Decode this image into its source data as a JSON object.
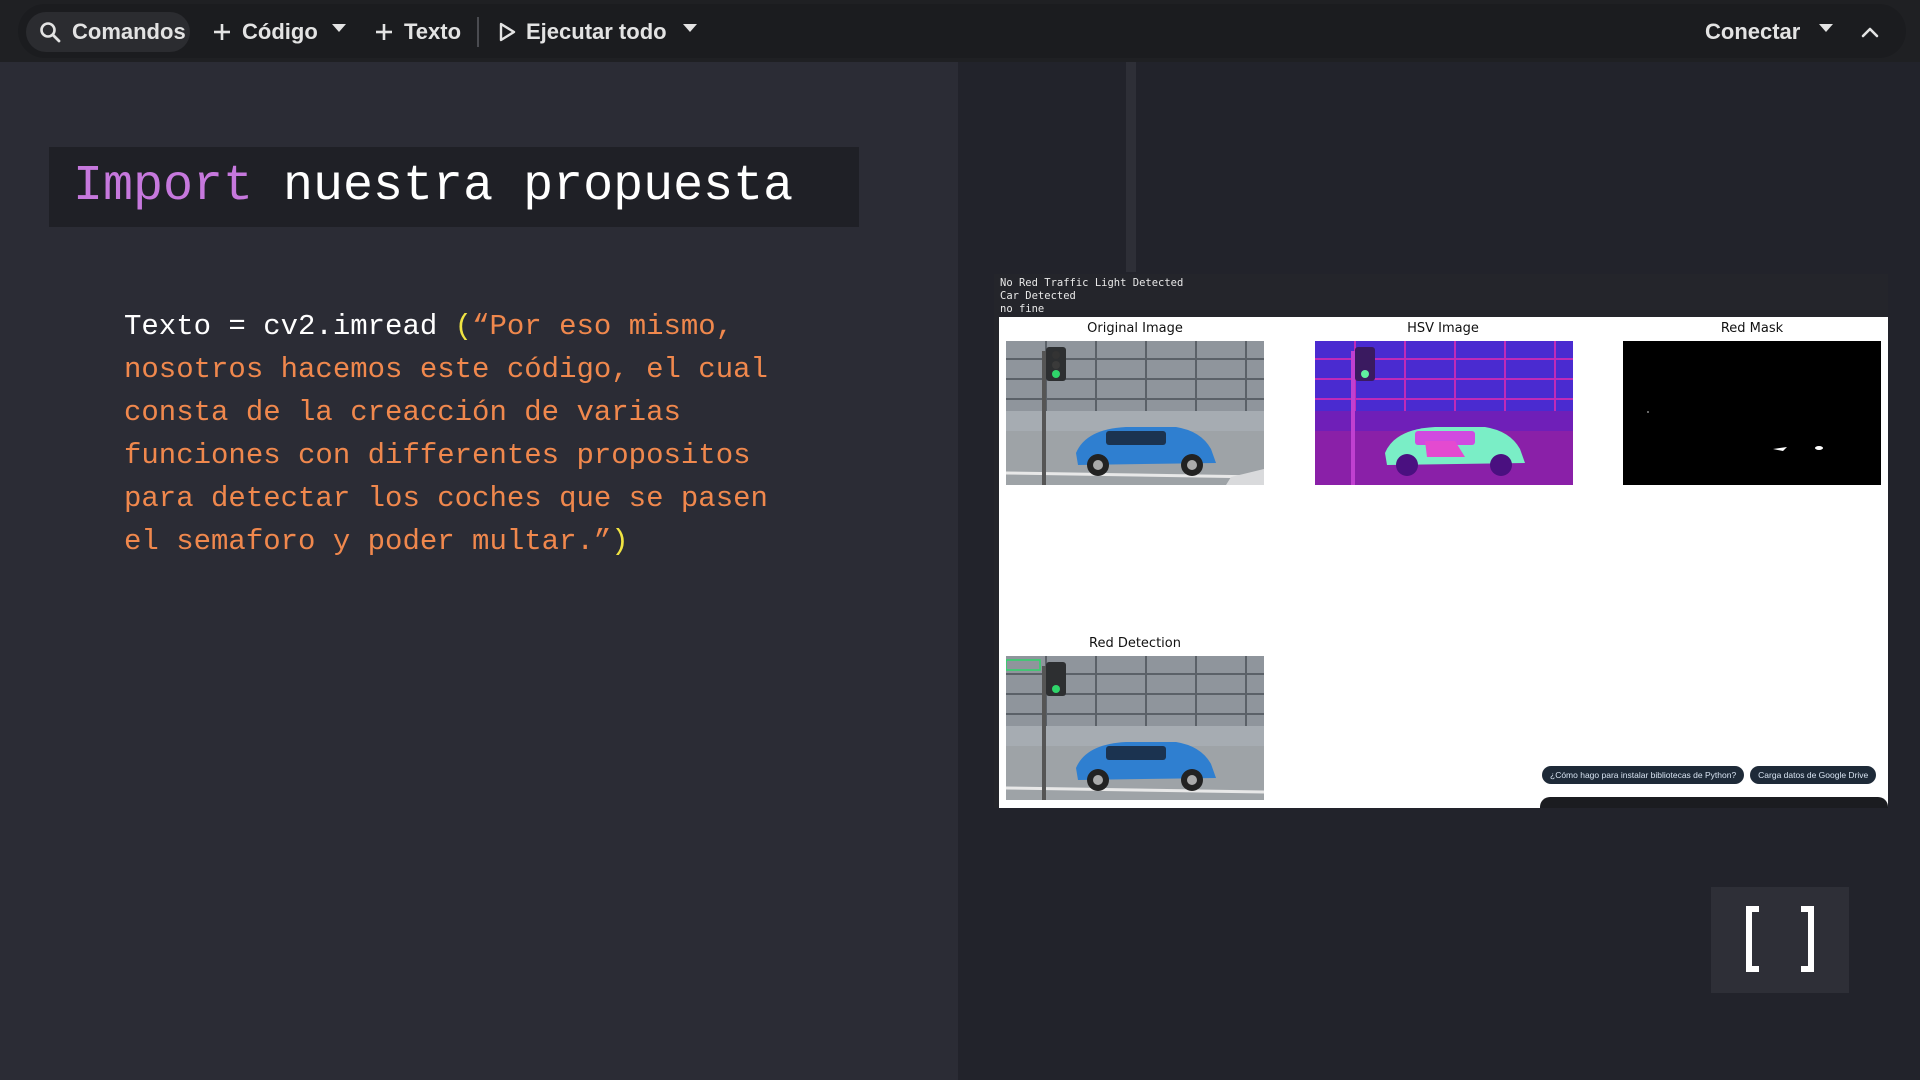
{
  "toolbar": {
    "commands_label": "Comandos",
    "code_label": "Código",
    "text_label": "Texto",
    "run_all_label": "Ejecutar todo",
    "connect_label": "Conectar",
    "icons": [
      "search-icon",
      "plus-icon",
      "chevron-down-icon",
      "play-icon",
      "chevron-up-icon"
    ]
  },
  "slide": {
    "title_keyword": "Import",
    "title_rest": " nuestra propuesta",
    "code_prefix": "Texto = cv2.imread ",
    "code_open": "(",
    "code_string": "“Por eso mismo,\nnosotros hacemos este código, el cual\nconsta de la creacción de varias\nfunciones con differentes propositos\npara detectar los coches que se pasen\nel semaforo y poder multar.”",
    "code_close": ")",
    "colors": {
      "keyword": "#c678dd",
      "string": "#f0884d",
      "paren": "#f0e442",
      "text": "#ffffff"
    }
  },
  "output": {
    "stdout": "No Red Traffic Light Detected\nCar Detected\nno fine",
    "subplots": [
      {
        "title": "Original Image"
      },
      {
        "title": "HSV Image"
      },
      {
        "title": "Red Mask"
      },
      {
        "title": "Red Detection"
      }
    ],
    "suggestions": [
      "¿Cómo hago para instalar bibliotecas de Python?",
      "Carga datos de Google Drive"
    ]
  },
  "fullscreen_button": {
    "icon": "brackets-icon"
  }
}
